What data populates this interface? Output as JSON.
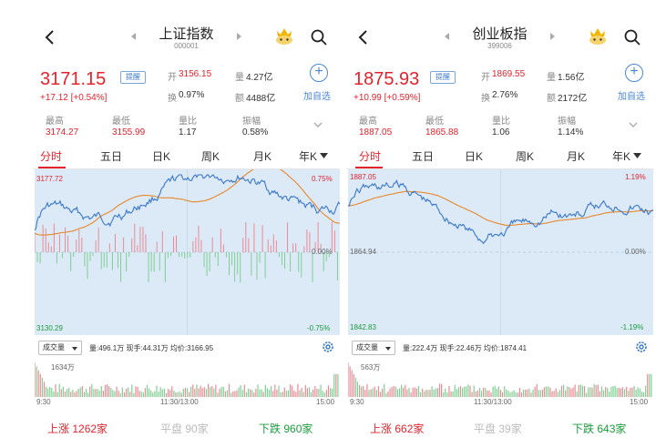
{
  "colors": {
    "up": "#e2232c",
    "down": "#1a9c3a",
    "accent": "#4a86d6",
    "chart_bg": "#dce9f7",
    "price_line": "#3a78c9",
    "avg_line": "#e8882a"
  },
  "panels": [
    {
      "title": "上证指数",
      "code": "000001",
      "price": "3171.15",
      "remind_label": "提醒",
      "change": "+17.12 [+0.54%]",
      "stats": [
        {
          "label": "开",
          "value": "3156.15",
          "tone": "red"
        },
        {
          "label": "量",
          "value": "4.27亿",
          "tone": "normal"
        },
        {
          "label": "换",
          "value": "0.97%",
          "tone": "normal"
        },
        {
          "label": "额",
          "value": "4488亿",
          "tone": "normal"
        }
      ],
      "add_label": "加自选",
      "metrics": [
        {
          "label": "最高",
          "value": "3174.27",
          "tone": "red"
        },
        {
          "label": "最低",
          "value": "3155.99",
          "tone": "red"
        },
        {
          "label": "量比",
          "value": "1.17",
          "tone": "normal"
        },
        {
          "label": "振幅",
          "value": "0.58%",
          "tone": "normal"
        }
      ],
      "tabs": [
        "分时",
        "五日",
        "日K",
        "周K",
        "月K",
        "年K"
      ],
      "active_tab": "分时",
      "y_top": "3177.72",
      "y_bottom": "3130.29",
      "pct_top": "0.75%",
      "pct_mid": "0.00%",
      "pct_bottom": "-0.75%",
      "volume_selector": "成交量",
      "volume_info": "量:496.1万  现手:44.31万  均价:3166.95",
      "volume_max": "1634万",
      "time_start": "9:30",
      "time_mid": "11:30/13:00",
      "time_end": "15:00",
      "up_label": "上涨",
      "up_count": "1262家",
      "flat_label": "平盘",
      "flat_count": "90家",
      "down_label": "下跌",
      "down_count": "960家"
    },
    {
      "title": "创业板指",
      "code": "399006",
      "price": "1875.93",
      "remind_label": "提醒",
      "change": "+10.99 [+0.59%]",
      "stats": [
        {
          "label": "开",
          "value": "1869.55",
          "tone": "red"
        },
        {
          "label": "量",
          "value": "1.56亿",
          "tone": "normal"
        },
        {
          "label": "换",
          "value": "2.76%",
          "tone": "normal"
        },
        {
          "label": "额",
          "value": "2172亿",
          "tone": "normal"
        }
      ],
      "add_label": "加自选",
      "metrics": [
        {
          "label": "最高",
          "value": "1887.05",
          "tone": "red"
        },
        {
          "label": "最低",
          "value": "1865.88",
          "tone": "red"
        },
        {
          "label": "量比",
          "value": "1.06",
          "tone": "normal"
        },
        {
          "label": "振幅",
          "value": "1.14%",
          "tone": "normal"
        }
      ],
      "tabs": [
        "分时",
        "五日",
        "日K",
        "周K",
        "月K",
        "年K"
      ],
      "active_tab": "分时",
      "y_top": "1887.05",
      "y_mid": "1864.94",
      "y_bottom": "1842.83",
      "pct_top": "1.19%",
      "pct_mid": "0.00%",
      "pct_bottom": "-1.19%",
      "volume_selector": "成交量",
      "volume_info": "量:222.4万  现手:22.46万  均价:1874.41",
      "volume_max": "563万",
      "time_start": "9:30",
      "time_mid": "11:30/13:00",
      "time_end": "15:00",
      "up_label": "上涨",
      "up_count": "662家",
      "flat_label": "平盘",
      "flat_count": "39家",
      "down_label": "下跌",
      "down_count": "643家"
    }
  ]
}
